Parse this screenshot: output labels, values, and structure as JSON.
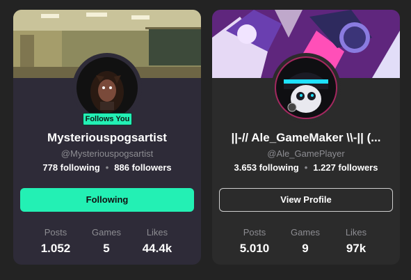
{
  "profiles": [
    {
      "display_name": "Mysteriouspogsartist",
      "handle": "@Mysteriouspogsartist",
      "following": "778 following",
      "followers": "886 followers",
      "badge": "Follows You",
      "action_label": "Following",
      "stats": [
        {
          "label": "Posts",
          "value": "1.052"
        },
        {
          "label": "Games",
          "value": "5"
        },
        {
          "label": "Likes",
          "value": "44.4k"
        }
      ]
    },
    {
      "display_name": "||-// Ale_GameMaker \\\\-|| (...",
      "handle": "@Ale_GamePlayer",
      "following": "3.653 following",
      "followers": "1.227 followers",
      "action_label": "View Profile",
      "stats": [
        {
          "label": "Posts",
          "value": "5.010"
        },
        {
          "label": "Games",
          "value": "9"
        },
        {
          "label": "Likes",
          "value": "97k"
        }
      ]
    }
  ],
  "colors": {
    "page_bg": "#232323",
    "card_bg": "#2e2b38",
    "accent": "#23f0b4",
    "muted_text": "#8d8d92"
  },
  "separator": "•"
}
